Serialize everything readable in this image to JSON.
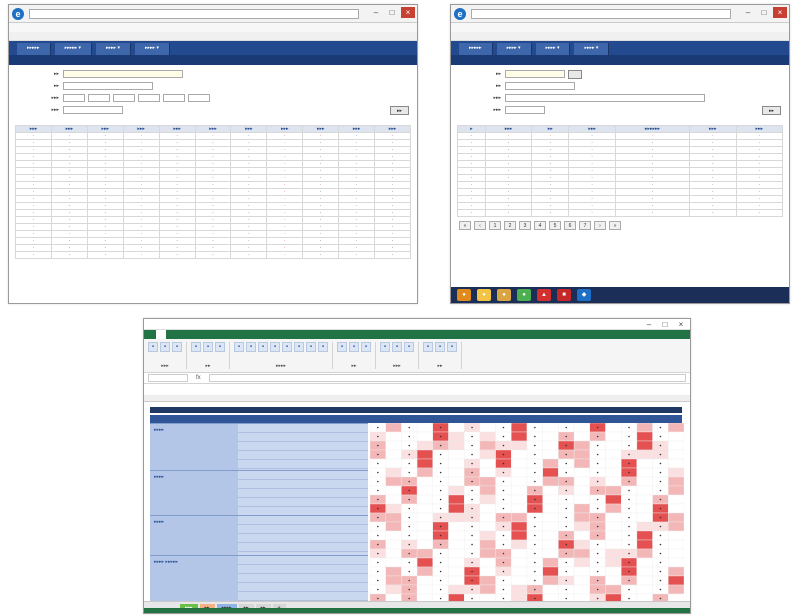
{
  "screen1": {
    "favicon": "e",
    "window_controls": [
      "–",
      "□",
      "×"
    ],
    "nav_tabs": [
      "▸▸▸▸▸",
      "▸▸▸▸▸ ▾",
      "▸▸▸▸ ▾",
      "▸▸▸▸ ▾"
    ],
    "form_labels": [
      "▸▸",
      "▸▸",
      "▸▸▸",
      "▸▸▸"
    ],
    "search_button": "▸▸",
    "columns": [
      "▸▸▸",
      "▸▸▸",
      "▸▸▸",
      "▸▸▸",
      "▸▸▸",
      "▸▸▸",
      "▸▸▸",
      "▸▸▸",
      "▸▸▸",
      "▸▸▸",
      "▸▸▸"
    ],
    "row_count": 18
  },
  "screen2": {
    "favicon": "e",
    "window_controls": [
      "–",
      "□",
      "×"
    ],
    "nav_tabs": [
      "▸▸▸▸▸",
      "▸▸▸▸ ▾",
      "▸▸▸▸ ▾",
      "▸▸▸▸ ▾"
    ],
    "form_labels": [
      "▸▸",
      "▸▸",
      "▸▸▸",
      "▸▸▸"
    ],
    "search_button": "▸▸",
    "columns": [
      "▸",
      "▸▸▸",
      "▸▸",
      "▸▸▸",
      "▸▸▸▸▸▸",
      "▸▸▸",
      "▸▸▸"
    ],
    "row_count": 12,
    "pager": [
      "«",
      "‹",
      "1",
      "2",
      "3",
      "4",
      "5",
      "6",
      "7",
      "›",
      "»"
    ],
    "taskbar_icons": [
      "●",
      "●",
      "●",
      "●",
      "▲",
      "■",
      "◆"
    ]
  },
  "screen3": {
    "ribbon_groups": [
      "▸▸▸",
      "▸▸",
      "▸▸▸▸",
      "▸▸",
      "▸▸▸",
      "▸▸"
    ],
    "formula_symbol": "fx",
    "groups": [
      "▸▸▸▸",
      "▸▸▸▸",
      "▸▸▸▸",
      "▸▸▸▸ ▸▸▸▸▸"
    ],
    "sheet_tabs": [
      "▸▸▸",
      "▸▸",
      "▸▸▸▸",
      "▸▸",
      "▸▸",
      "+"
    ],
    "accent": "#217346",
    "heat_color": "#e03131"
  }
}
